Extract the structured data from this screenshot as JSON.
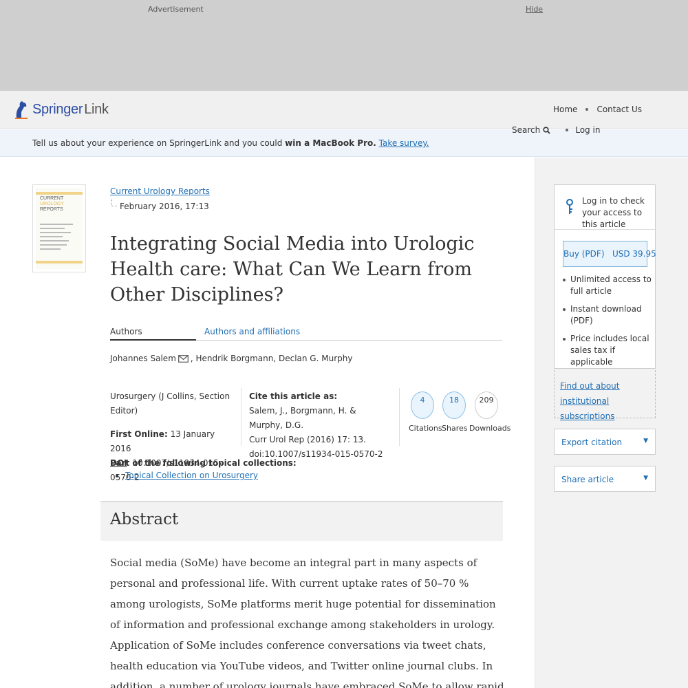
{
  "ad": {
    "label": "Advertisement",
    "hide": "Hide"
  },
  "brand": {
    "name": "Springer",
    "suffix": "Link"
  },
  "nav": {
    "home": "Home",
    "contact": "Contact Us",
    "search": "Search",
    "login": "Log in"
  },
  "survey": {
    "text": "Tell us about your experience on SpringerLink and you could",
    "bold": "win a MacBook Pro.",
    "link": "Take survey."
  },
  "cover": {
    "title_lines": [
      "CURRENT",
      "UROLOGY",
      "REPORTS"
    ]
  },
  "article": {
    "journal": "Current Urology Reports",
    "date": "February 2016, 17:13",
    "title": "Integrating Social Media into Urologic Health care: What Can We Learn from Other Disciplines?",
    "tab_authors": "Authors",
    "tab_affiliations": "Authors and affiliations",
    "author1": "Johannes Salem",
    "authors_rest": ", Hendrik Borgmann, Declan G. Murphy",
    "section": "Urosurgery (J Collins, Section Editor)",
    "first_online_label": "First Online:",
    "first_online": " 13 January 2016",
    "doi_label": "DOI",
    "doi": ": 10.1007/s11934-015-0570-2",
    "cite_label": "Cite this article as:",
    "cite_line1": "Salem, J., Borgmann, H. & Murphy, D.G.",
    "cite_line2": "Curr Urol Rep (2016) 17: 13.",
    "cite_line3": "doi:10.1007/s11934-015-0570-2",
    "collections_label": "Part of the following topical collections:",
    "collection_item": "Topical Collection on Urosurgery"
  },
  "metrics": {
    "citations": {
      "value": "4",
      "label": "Citations"
    },
    "shares": {
      "value": "18",
      "label": "Shares"
    },
    "downloads": {
      "value": "209",
      "label": "Downloads"
    }
  },
  "abstract": {
    "heading": "Abstract",
    "text": "Social media (SoMe) have become an integral part in many aspects of personal and professional life. With current uptake rates of 50–70 % among urologists, SoMe platforms merit huge potential for dissemination of information and professional exchange among stakeholders in urology. Application of SoMe includes conference conversations via tweet chats, health education via YouTube videos, and Twitter online journal clubs. In addition, a number of urology journals have embraced SoMe to allow rapid dissemination of their content and engagement with their readers"
  },
  "sidebar": {
    "access_text": "Log in to check your access to this article",
    "buy": "Buy (PDF)   USD 39.95",
    "benefits": [
      "Unlimited access to full article",
      "Instant download (PDF)",
      "Price includes local sales tax if applicable"
    ],
    "institutional": "Find out about institutional subscriptions",
    "export": "Export citation",
    "share": "Share article"
  },
  "colors": {
    "link": "#1f6fb5",
    "brand": "#2c4ea3",
    "accent_orange": "#e87722"
  }
}
